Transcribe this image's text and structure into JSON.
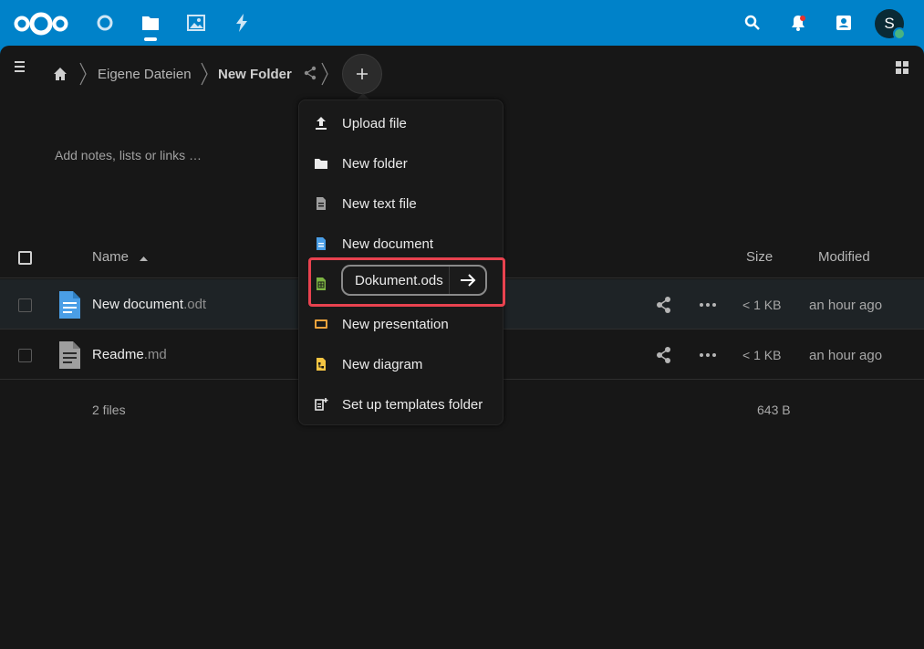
{
  "header": {
    "icons": [
      "nextcloud-logo",
      "dashboard-icon",
      "files-icon",
      "photos-icon",
      "activity-icon",
      "search-icon",
      "bell-icon",
      "contacts-icon"
    ],
    "avatar_initial": "S",
    "brand_color": "#0082c9"
  },
  "breadcrumb": {
    "items": [
      "Eigene Dateien",
      "New Folder"
    ]
  },
  "notes_placeholder": "Add notes, lists or links …",
  "table": {
    "headers": {
      "name": "Name",
      "size": "Size",
      "modified": "Modified"
    },
    "rows": [
      {
        "name": "New document",
        "ext": ".odt",
        "size": "< 1 KB",
        "modified": "an hour ago",
        "icon": "document-icon",
        "icon_color": "#4a9ee6"
      },
      {
        "name": "Readme",
        "ext": ".md",
        "size": "< 1 KB",
        "modified": "an hour ago",
        "icon": "text-file-icon",
        "icon_color": "#9e9e9e"
      }
    ],
    "summary": {
      "count": "2 files",
      "total": "643 B"
    }
  },
  "new_menu": {
    "items": [
      {
        "label": "Upload file",
        "icon": "upload-icon"
      },
      {
        "label": "New folder",
        "icon": "folder-icon"
      },
      {
        "label": "New text file",
        "icon": "text-file-icon"
      },
      {
        "label": "New document",
        "icon": "document-icon",
        "color": "#4a9ee6"
      },
      {
        "label": "",
        "icon": "spreadsheet-icon",
        "color": "#7cb342"
      },
      {
        "label": "New presentation",
        "icon": "presentation-icon",
        "color": "#f0a33c"
      },
      {
        "label": "New diagram",
        "icon": "diagram-icon",
        "color": "#f5c542"
      },
      {
        "label": "Set up templates folder",
        "icon": "templates-icon"
      }
    ],
    "filename_value": "Dokument.ods"
  }
}
